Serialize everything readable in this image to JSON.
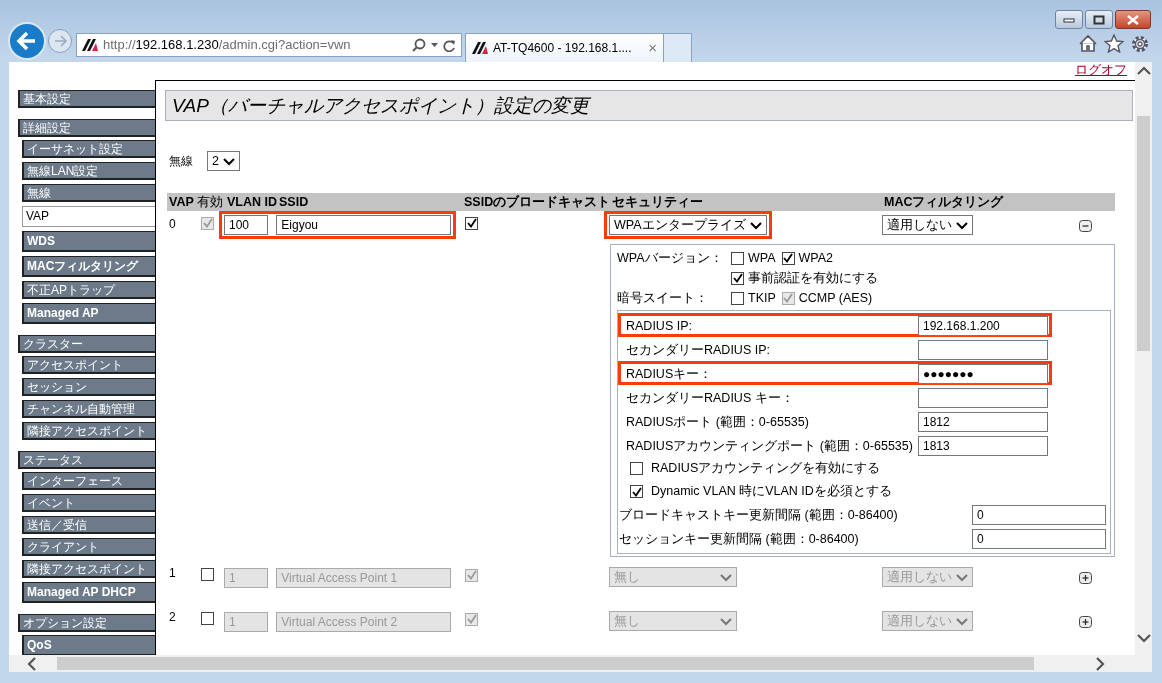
{
  "browser": {
    "address_parts": [
      {
        "text": "http://",
        "emphasized": false
      },
      {
        "text": "192.168.1.230",
        "emphasized": true
      },
      {
        "text": "/admin.cgi?action=vwn",
        "emphasized": false
      }
    ],
    "tab": {
      "title": "AT-TQ4600 - 192.168.1....",
      "close": "×"
    }
  },
  "logoff": "ログオフ",
  "sidebar": [
    {
      "label": "基本設定"
    },
    {
      "label": "詳細設定",
      "children": [
        {
          "label": "イーサネット設定",
          "bold": false,
          "selected": false
        },
        {
          "label": "無線LAN設定",
          "bold": false,
          "selected": false
        },
        {
          "label": "無線",
          "bold": false,
          "selected": false
        },
        {
          "label": "VAP",
          "bold": true,
          "selected": true
        },
        {
          "label": "WDS",
          "bold": true,
          "selected": false
        },
        {
          "label": "MACフィルタリング",
          "bold": true,
          "selected": false
        },
        {
          "label": "不正APトラップ",
          "bold": false,
          "selected": false
        },
        {
          "label": "Managed AP",
          "bold": true,
          "selected": false
        }
      ]
    },
    {
      "label": "クラスター",
      "children": [
        {
          "label": "アクセスポイント",
          "bold": false,
          "selected": false
        },
        {
          "label": "セッション",
          "bold": false,
          "selected": false
        },
        {
          "label": "チャンネル自動管理",
          "bold": false,
          "selected": false
        },
        {
          "label": "隣接アクセスポイント",
          "bold": false,
          "selected": false
        }
      ]
    },
    {
      "label": "ステータス",
      "children": [
        {
          "label": "インターフェース",
          "bold": false,
          "selected": false
        },
        {
          "label": "イベント",
          "bold": false,
          "selected": false
        },
        {
          "label": "送信／受信",
          "bold": false,
          "selected": false
        },
        {
          "label": "クライアント",
          "bold": false,
          "selected": false
        },
        {
          "label": "隣接アクセスポイント",
          "bold": false,
          "selected": false
        },
        {
          "label": "Managed AP DHCP",
          "bold": true,
          "selected": false
        }
      ]
    },
    {
      "label": "オプション設定",
      "children": [
        {
          "label": "QoS",
          "bold": true,
          "selected": false
        }
      ]
    }
  ],
  "page_title": "VAP（バーチャルアクセスポイント）設定の変更",
  "radio": {
    "label": "無線",
    "value": "2"
  },
  "table": {
    "columns": [
      "VAP",
      "有効",
      "VLAN ID",
      "SSID",
      "SSIDのブロードキャスト",
      "セキュリティー",
      "MACフィルタリング"
    ],
    "rows": [
      {
        "vap": "0",
        "disabled": false,
        "enabled": {
          "checked": true,
          "disabled": true
        },
        "vlan_id": "100",
        "ssid": "Eigyou",
        "vlan_ssid_highlighted": true,
        "broadcast": {
          "checked": true,
          "disabled": false
        },
        "security": "WPAエンタープライズ",
        "security_highlighted": true,
        "mac_filter": "適用しない",
        "expanded": true,
        "details": {
          "wpa_label": "WPAバージョン：",
          "wpa_versions": [
            {
              "label": "WPA",
              "checked": false,
              "disabled": false
            },
            {
              "label": "WPA2",
              "checked": true,
              "disabled": false
            }
          ],
          "preauth": {
            "label": "事前認証を有効にする",
            "checked": true,
            "disabled": false
          },
          "cipher_label": "暗号スイート：",
          "ciphers": [
            {
              "label": "TKIP",
              "checked": false,
              "disabled": false
            },
            {
              "label": "CCMP (AES)",
              "checked": true,
              "disabled": true
            }
          ],
          "radius_fields": [
            {
              "label": "RADIUS IP:",
              "value": "192.168.1.200",
              "highlighted": true
            },
            {
              "label": "セカンダリーRADIUS IP:",
              "highlighted": false
            },
            {
              "label": "RADIUSキー：",
              "value": "●●●●●●●",
              "highlighted": true
            },
            {
              "label": "セカンダリーRADIUS キー：",
              "highlighted": false
            },
            {
              "label": "RADIUSポート (範囲：0-65535)",
              "value": "1812",
              "highlighted": false
            },
            {
              "label": "RADIUSアカウンティングポート (範囲：0-65535)",
              "value": "1813",
              "highlighted": false
            }
          ],
          "options": [
            {
              "label": "RADIUSアカウンティングを有効にする",
              "checked": false,
              "disabled": false
            },
            {
              "label": "Dynamic VLAN 時にVLAN IDを必須とする",
              "checked": true,
              "disabled": false
            }
          ],
          "intervals": [
            {
              "label": "ブロードキャストキー更新間隔 (範囲：0-86400)",
              "value": "0"
            },
            {
              "label": "セッションキー更新間隔 (範囲：0-86400)",
              "value": "0"
            }
          ]
        }
      },
      {
        "vap": "1",
        "disabled": true,
        "enabled": {
          "checked": false,
          "disabled": false
        },
        "vlan_id": "1",
        "ssid": "Virtual Access Point 1",
        "vlan_ssid_highlighted": false,
        "broadcast": {
          "checked": true,
          "disabled": true
        },
        "security": "無し",
        "security_highlighted": false,
        "mac_filter": "適用しない",
        "expanded": false
      },
      {
        "vap": "2",
        "disabled": true,
        "enabled": {
          "checked": false,
          "disabled": false
        },
        "vlan_id": "1",
        "ssid": "Virtual Access Point 2",
        "vlan_ssid_highlighted": false,
        "broadcast": {
          "checked": true,
          "disabled": true
        },
        "security": "無し",
        "security_highlighted": false,
        "mac_filter": "適用しない",
        "expanded": false
      }
    ]
  }
}
